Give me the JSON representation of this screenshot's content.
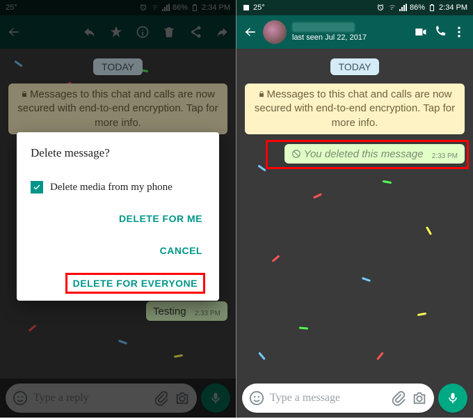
{
  "left": {
    "statusbar": {
      "temp": "25°",
      "battery": "86%",
      "time": "2:34 PM"
    },
    "chat": {
      "today": "TODAY",
      "encryption": "Messages to this chat and calls are now secured with end-to-end encryption. Tap for more info.",
      "bubble_text": "Testing",
      "bubble_time": "2:33 PM"
    },
    "input": {
      "placeholder": "Type a reply"
    },
    "dialog": {
      "title": "Delete message?",
      "checkbox_label": "Delete media from my phone",
      "btn_me": "DELETE FOR ME",
      "btn_cancel": "CANCEL",
      "btn_everyone": "DELETE FOR EVERYONE"
    }
  },
  "right": {
    "statusbar": {
      "temp": "25°",
      "battery": "86%",
      "time": "2:34 PM"
    },
    "header": {
      "last_seen": "last seen Jul 22, 2017"
    },
    "chat": {
      "today": "TODAY",
      "encryption": "Messages to this chat and calls are now secured with end-to-end encryption. Tap for more info.",
      "deleted_text": "You deleted this message",
      "deleted_time": "2:33 PM"
    },
    "input": {
      "placeholder": "Type a message"
    }
  }
}
